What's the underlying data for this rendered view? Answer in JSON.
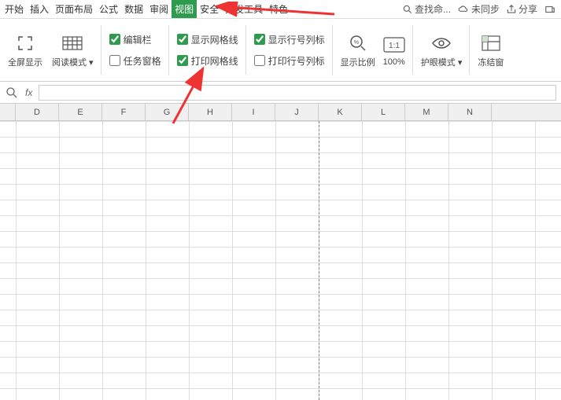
{
  "menu": {
    "items": [
      "开始",
      "插入",
      "页面布局",
      "公式",
      "数据",
      "审阅",
      "视图",
      "安全",
      "开发工具",
      "特色"
    ],
    "active": 6
  },
  "topright": {
    "search": "查找命...",
    "sync": "未同步",
    "share": "分享"
  },
  "toolbar": {
    "fullscreen": "全屏显示",
    "readmode": "阅读模式",
    "chk_formula_bar": "编辑栏",
    "chk_task_pane": "任务窗格",
    "chk_show_grid": "显示网格线",
    "chk_print_grid": "打印网格线",
    "chk_show_headings": "显示行号列标",
    "chk_print_headings": "打印行号列标",
    "zoom_ratio": "显示比例",
    "zoom_100": "100%",
    "eye_mode": "护眼模式",
    "freeze": "冻结窗"
  },
  "fx": {
    "fx_label": "fx",
    "value": ""
  },
  "columns": [
    "D",
    "E",
    "F",
    "G",
    "H",
    "I",
    "J",
    "K",
    "L",
    "M",
    "N"
  ]
}
